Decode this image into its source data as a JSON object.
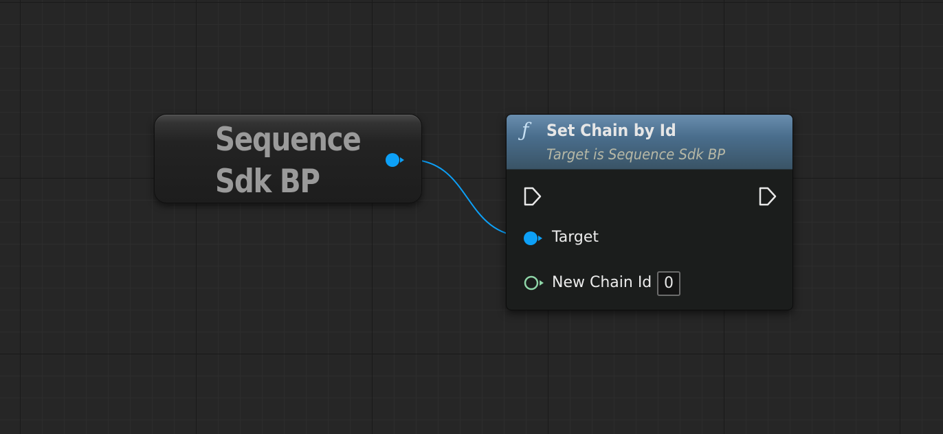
{
  "graph": {
    "variable_node": {
      "title": "Sequence\nSdk BP",
      "pin_color": "#0da0f7"
    },
    "function_node": {
      "icon": "function-icon",
      "icon_glyph": "ƒ",
      "title": "Set Chain by Id",
      "subtitle": "Target is Sequence Sdk BP",
      "header_color": "#4a6e8d",
      "pins": {
        "exec_in": "exec-in-pin-icon",
        "exec_out": "exec-out-pin-icon",
        "target_label": "Target",
        "new_chain_id_label": "New Chain Id",
        "new_chain_id_value": "0"
      },
      "integer_pin_color": "#1fe3af"
    },
    "wire_color": "#0da0f7"
  }
}
